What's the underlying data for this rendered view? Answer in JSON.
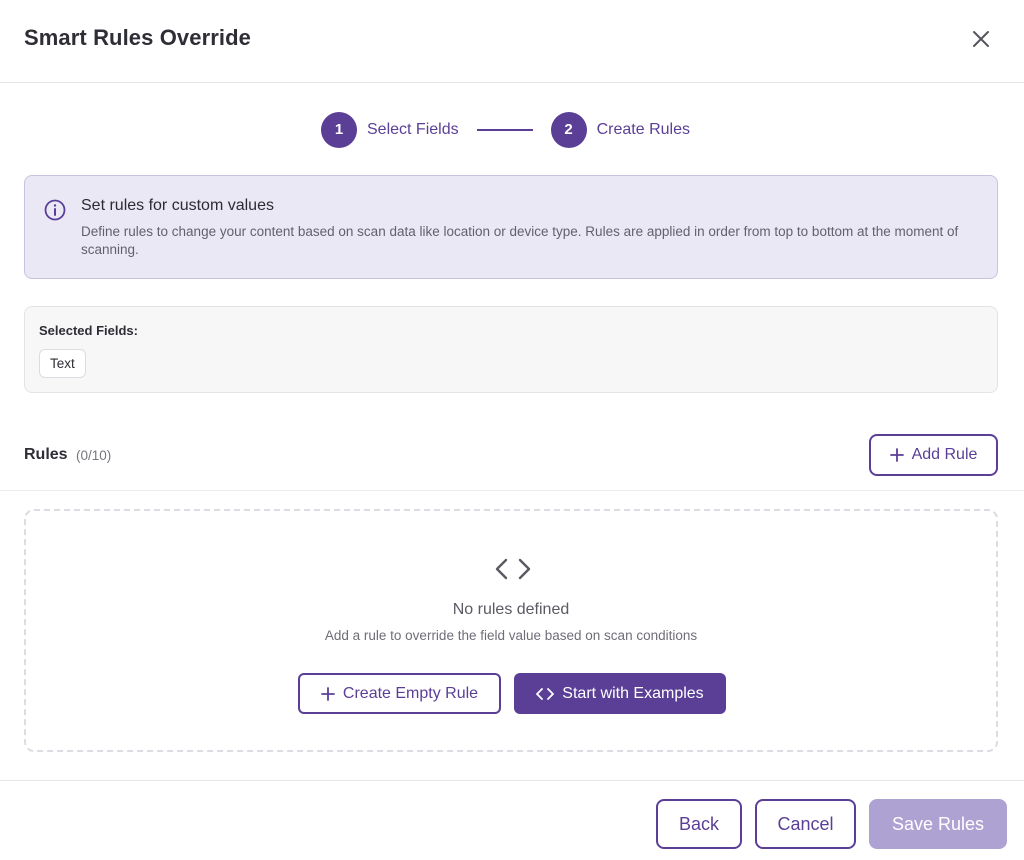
{
  "dialog": {
    "title": "Smart Rules Override",
    "close_icon": "close-icon"
  },
  "stepper": {
    "steps": [
      {
        "number": "1",
        "label": "Select Fields"
      },
      {
        "number": "2",
        "label": "Create Rules"
      }
    ]
  },
  "info": {
    "icon": "info-icon",
    "title": "Set rules for custom values",
    "text": "Define rules to change your content based on scan data like location or device type. Rules are applied in order from top to bottom at the moment of scanning."
  },
  "selected_fields": {
    "label": "Selected Fields:",
    "fields": [
      "Text"
    ]
  },
  "rules": {
    "title": "Rules",
    "count": "(0/10)",
    "add_label": "Add Rule",
    "empty_title": "No rules defined",
    "empty_subtitle": "Add a rule to override the field value based on scan conditions",
    "create_empty_label": "Create Empty Rule",
    "examples_label": "Start with Examples"
  },
  "footer": {
    "back_label": "Back",
    "cancel_label": "Cancel",
    "save_label": "Save Rules"
  },
  "colors": {
    "accent": "#5b3f97",
    "accent_disabled": "#aea2d2",
    "info_bg": "#ebe8f6"
  }
}
